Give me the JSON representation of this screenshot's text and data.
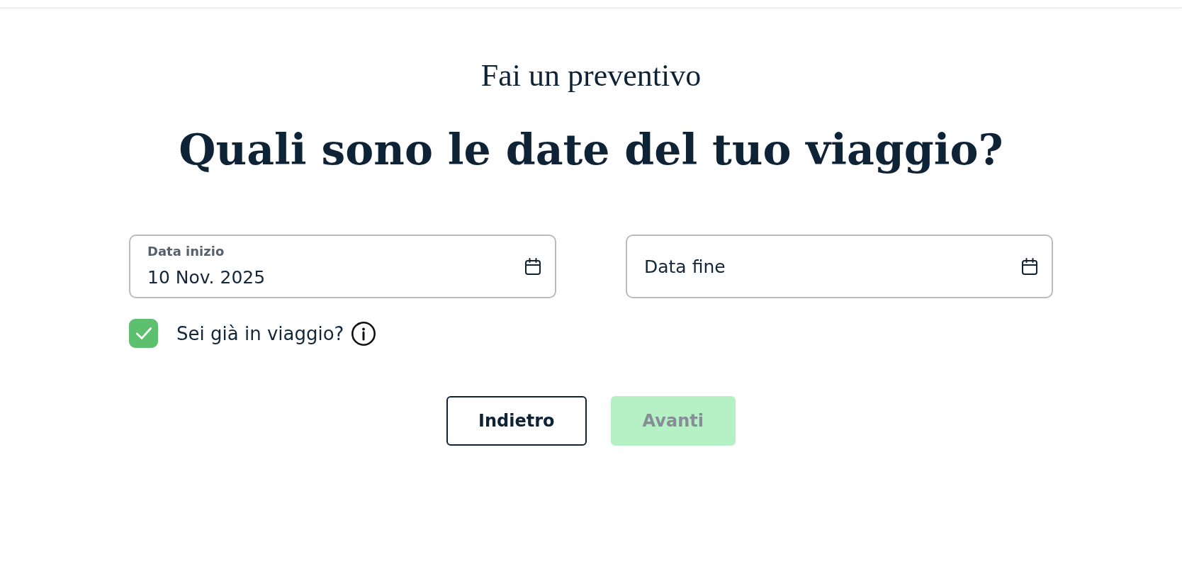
{
  "eyebrow": "Fai un preventivo",
  "title": "Quali sono le date del tuo viaggio?",
  "date_fields": [
    {
      "label": "Data inizio",
      "value": "10 Nov. 2025"
    },
    {
      "placeholder": "Data fine"
    }
  ],
  "already_travelling": {
    "label": "Sei già in viaggio?",
    "checked": true
  },
  "buttons": [
    {
      "label": "Indietro",
      "kind": "secondary",
      "disabled": false
    },
    {
      "label": "Avanti",
      "kind": "primary",
      "disabled": true
    }
  ]
}
